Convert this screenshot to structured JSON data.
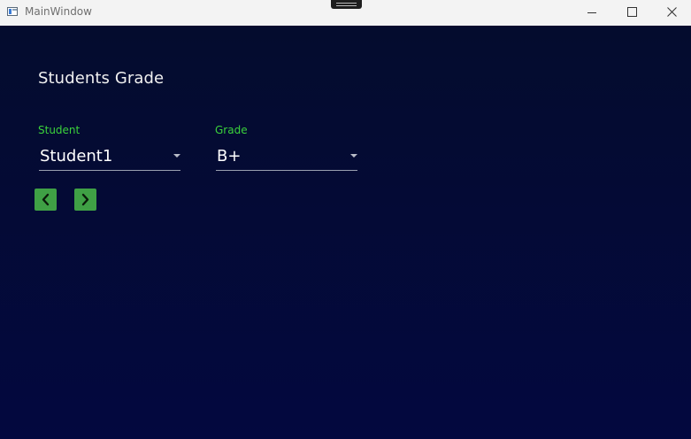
{
  "window": {
    "title": "MainWindow"
  },
  "page": {
    "title": "Students Grade"
  },
  "student_field": {
    "label": "Student",
    "value": "Student1"
  },
  "grade_field": {
    "label": "Grade",
    "value": "B+"
  },
  "navigation": {
    "previous_icon": "chevron-left-icon",
    "next_icon": "chevron-right-icon"
  },
  "colors": {
    "accent_label": "#3bd23b",
    "nav_button": "#3fa045",
    "background_top": "#040c2e",
    "background_bottom": "#03083f"
  }
}
